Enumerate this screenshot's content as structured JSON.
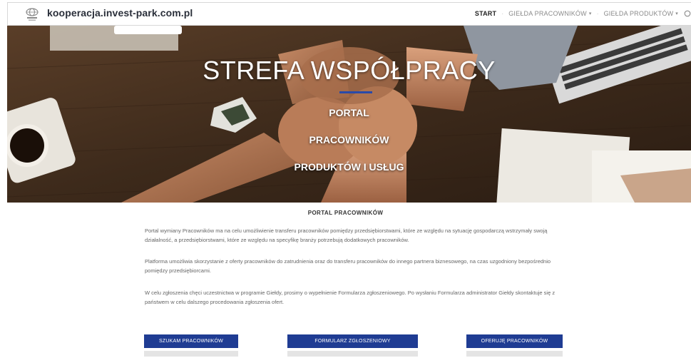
{
  "header": {
    "site_name": "kooperacja.invest-park.com.pl",
    "nav": [
      {
        "label": "START",
        "active": true,
        "dropdown": false
      },
      {
        "label": "GIEŁDA PRACOWNIKÓW",
        "active": false,
        "dropdown": true
      },
      {
        "label": "GIEŁDA PRODUKTÓW",
        "active": false,
        "dropdown": true
      }
    ],
    "icons": {
      "logo": "logo-icon",
      "search": "search-icon",
      "dropdown": "chevron-down-icon"
    }
  },
  "hero": {
    "title": "STREFA WSPÓŁPRACY",
    "lines": [
      "PORTAL",
      "PRACOWNIKÓW",
      "PRODUKTÓW I USŁUG"
    ],
    "accent_color": "#2a4aa8"
  },
  "content": {
    "title": "PORTAL PRACOWNIKÓW",
    "paragraphs": [
      "Portal wymiany Pracowników ma na celu umożliwienie transferu pracowników pomiędzy przedsiębiorstwami, które ze względu na sytuację gospodarczą wstrzymały swoją działalność, a przedsiębiorstwami, które ze względu na specyfikę branży potrzebują dodatkowych pracowników.",
      "Platforma umożliwia skorzystanie z oferty pracowników do zatrudnienia oraz do transferu pracowników do innego partnera biznesowego, na czas uzgodniony bezpośrednio pomiędzy przedsiębiorcami.",
      "W celu zgłoszenia chęci uczestnictwa w programie Giełdy, prosimy o wypełnienie Formularza zgłoszeniowego. Po wysłaniu Formularza administrator Giełdy skontaktuje się z państwem w celu dalszego procedowania zgłoszenia ofert."
    ],
    "buttons": [
      "SZUKAM PRACOWNIKÓW",
      "FORMULARZ ZGŁOSZENIOWY",
      "OFERUJĘ PRACOWNIKÓW"
    ],
    "button_color": "#1f3c93"
  }
}
